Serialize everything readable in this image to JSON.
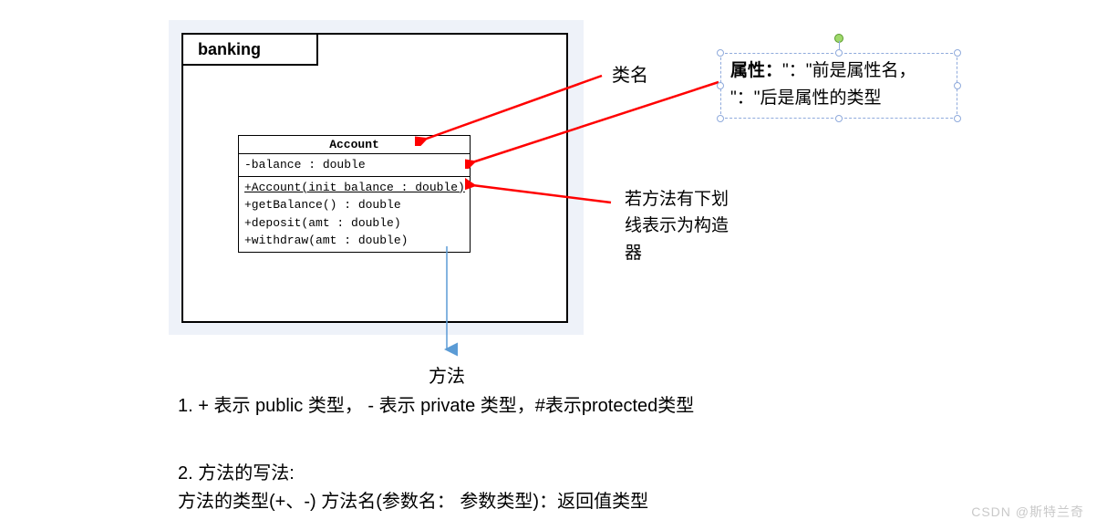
{
  "package": {
    "name": "banking"
  },
  "uml": {
    "className": "Account",
    "attribute": "-balance : double",
    "methods": {
      "constructor": "+Account(init_balance : double)",
      "m2": "+getBalance() : double",
      "m3": "+deposit(amt : double)",
      "m4": "+withdraw(amt : double)"
    }
  },
  "labels": {
    "className": "类名",
    "attr_line1": "属性：\"：\"前是属性名，",
    "attr_line2": "\"：\"后是属性的类型",
    "constructor_l1": "若方法有下划",
    "constructor_l2": "线表示为构造",
    "constructor_l3": "器",
    "method": "方法"
  },
  "notes": {
    "line1": "1. + 表示 public 类型，  - 表示 private 类型，#表示protected类型",
    "line2a": "2. 方法的写法:",
    "line2b": "方法的类型(+、-)  方法名(参数名：  参数类型)：返回值类型"
  },
  "watermark": "CSDN @斯特兰奇"
}
